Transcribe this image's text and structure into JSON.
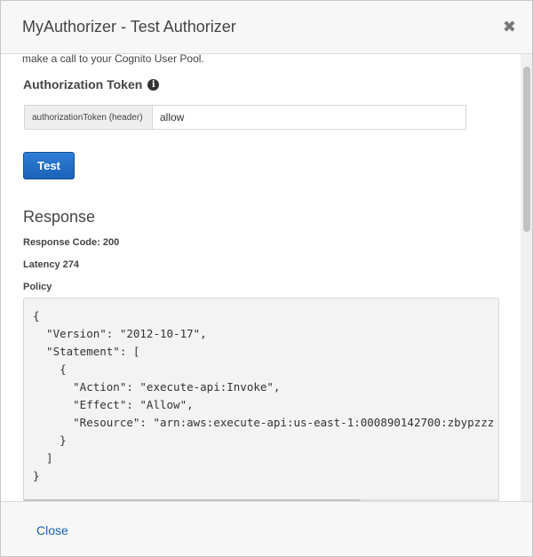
{
  "header": {
    "title": "MyAuthorizer - Test Authorizer",
    "close_glyph": "✖"
  },
  "body": {
    "intro_text": "make a call to your Cognito User Pool.",
    "auth_token": {
      "label": "Authorization Token",
      "info_icon": "info-icon",
      "field_label": "authorizationToken (header)",
      "value": "allow"
    },
    "test_button": "Test",
    "response": {
      "title": "Response",
      "code_line": "Response Code: 200",
      "latency_line": "Latency 274",
      "policy_label": "Policy",
      "policy_text": "{\n  \"Version\": \"2012-10-17\",\n  \"Statement\": [\n    {\n      \"Action\": \"execute-api:Invoke\",\n      \"Effect\": \"Allow\",\n      \"Resource\": \"arn:aws:execute-api:us-east-1:000890142700:zbypzzz\n    }\n  ]\n}"
    }
  },
  "footer": {
    "close_label": "Close"
  },
  "colors": {
    "primary_button": "#1a62b8",
    "link": "#1a62b8"
  }
}
